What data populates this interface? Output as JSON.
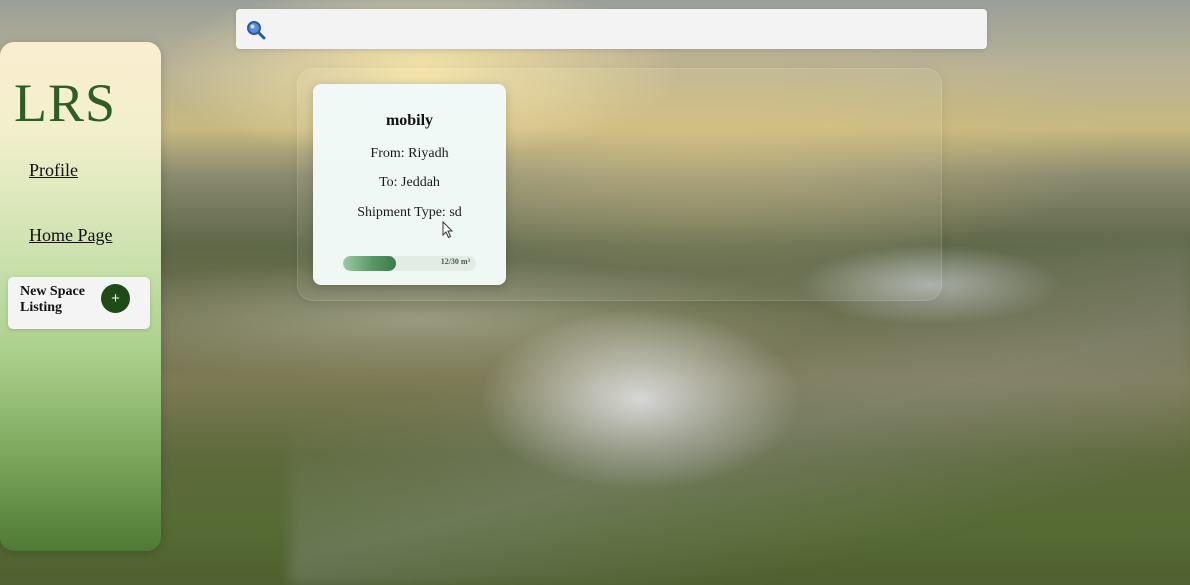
{
  "sidebar": {
    "logo": "LRS",
    "links": {
      "profile": "Profile",
      "home": "Home Page"
    },
    "new_listing": {
      "label": "New Space Listing",
      "button": "+"
    },
    "accent_color": "#1f4b17"
  },
  "search": {
    "icon": "search-icon",
    "value": "",
    "placeholder": ""
  },
  "shipments": [
    {
      "company": "mobily",
      "from": "From: Riyadh",
      "to": "To: Jeddah",
      "type": "Shipment Type: sd",
      "capacity_label": "12/30 m³",
      "used": 12,
      "total": 30
    }
  ]
}
